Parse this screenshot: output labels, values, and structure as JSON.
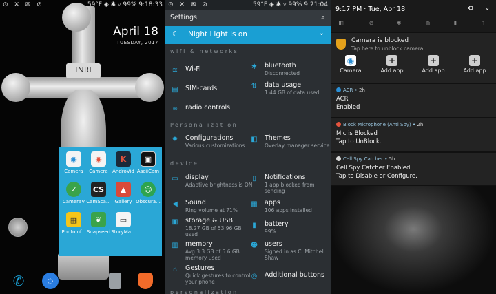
{
  "home": {
    "status_left": "⊙ ✕ ✉ ⊘",
    "status_time": "59°F ◈ ✱ ▿ 99% 9:18:33",
    "date_big": "April 18",
    "date_small": "TUESDAY, 2017",
    "inri": "INRI",
    "folder_apps": [
      {
        "label": "Camera",
        "icon": "camera-icon",
        "color": "#f4f4f4"
      },
      {
        "label": "Camera",
        "icon": "camera-icon",
        "color": "#f4f4f4"
      },
      {
        "label": "AndroVid",
        "icon": "video-icon",
        "color": "#1b2a3a"
      },
      {
        "label": "AsciiCam",
        "icon": "ascii-camera-icon",
        "color": "#111"
      },
      {
        "label": "CameraV",
        "icon": "camera-check-icon",
        "color": "#3aa34a"
      },
      {
        "label": "CamSca...",
        "icon": "camscanner-icon",
        "color": "#222"
      },
      {
        "label": "Gallery",
        "icon": "gallery-icon",
        "color": "#d94a3a"
      },
      {
        "label": "Obscura...",
        "icon": "obscura-icon",
        "color": "#2ea44f"
      },
      {
        "label": "PhotoInf...",
        "icon": "photo-info-icon",
        "color": "#f5c518"
      },
      {
        "label": "Snapseed",
        "icon": "snapseed-icon",
        "color": "#3aa34a"
      },
      {
        "label": "StoryMa...",
        "icon": "storymaker-icon",
        "color": "#f4f4f4"
      }
    ],
    "dock": [
      {
        "icon": "phone-icon",
        "color": "#1a9fd3"
      },
      {
        "icon": "messages-icon",
        "color": "#2a7de1"
      },
      {
        "icon": "signal-app-icon",
        "color": "#9aa0a5"
      },
      {
        "icon": "brave-browser-icon",
        "color": "#f26b2a"
      }
    ]
  },
  "settings": {
    "status_left": "⊙ ✕ ✉ ⊘",
    "status_time": "59°F ◈ ✱ ▿ 99% 9:21:04",
    "title": "Settings",
    "night_light": "Night Light is on",
    "sections": {
      "wifi": "wifi & networks",
      "personalization": "Personalization",
      "device": "device",
      "bottom": "personalization"
    },
    "items": {
      "wifi": {
        "title": "Wi-Fi",
        "sub": ""
      },
      "bluetooth": {
        "title": "bluetooth",
        "sub": "Disconnected"
      },
      "sim": {
        "title": "SIM-cards",
        "sub": ""
      },
      "data": {
        "title": "data usage",
        "sub": "1.44 GB of data used"
      },
      "radio": {
        "title": "radio controls",
        "sub": ""
      },
      "config": {
        "title": "Configurations",
        "sub": "Various customizations"
      },
      "themes": {
        "title": "Themes",
        "sub": "Overlay manager service"
      },
      "display": {
        "title": "display",
        "sub": "Adaptive brightness is ON"
      },
      "notifications": {
        "title": "Notifications",
        "sub": "1 app blocked from sending"
      },
      "sound": {
        "title": "Sound",
        "sub": "Ring volume at 71%"
      },
      "apps": {
        "title": "apps",
        "sub": "106 apps installed"
      },
      "storage": {
        "title": "storage & USB",
        "sub": "18.27 GB of 53.96 GB used"
      },
      "battery": {
        "title": "battery",
        "sub": "99%"
      },
      "memory": {
        "title": "memory",
        "sub": "Avg 3.3 GB of 5.6 GB memory used"
      },
      "users": {
        "title": "users",
        "sub": "Signed in as C. Mitchell Shaw"
      },
      "gestures": {
        "title": "Gestures",
        "sub": "Quick gestures to control your phone"
      },
      "additional": {
        "title": "Additional buttons",
        "sub": ""
      }
    }
  },
  "notifications": {
    "time": "9:17 PM · Tue, Apr 18",
    "camera": {
      "title": "Camera is blocked",
      "subtitle": "Tap here to unblock camera.",
      "options": [
        "Camera",
        "Add app",
        "Add app",
        "Add app"
      ]
    },
    "list": [
      {
        "app": "ACR",
        "age": "2h",
        "line1": "ACR",
        "line2": "Enabled",
        "color": "#2a8fd6"
      },
      {
        "app": "Block Microphone (Anti Spy)",
        "age": "2h",
        "line1": "Mic is Blocked",
        "line2": "Tap to UnBlock.",
        "color": "#e5533d"
      },
      {
        "app": "Cell Spy Catcher",
        "age": "5h",
        "line1": "Cell Spy Catcher Enabled",
        "line2": "Tap to Disable or Configure.",
        "color": "#d9d9d9"
      }
    ]
  }
}
